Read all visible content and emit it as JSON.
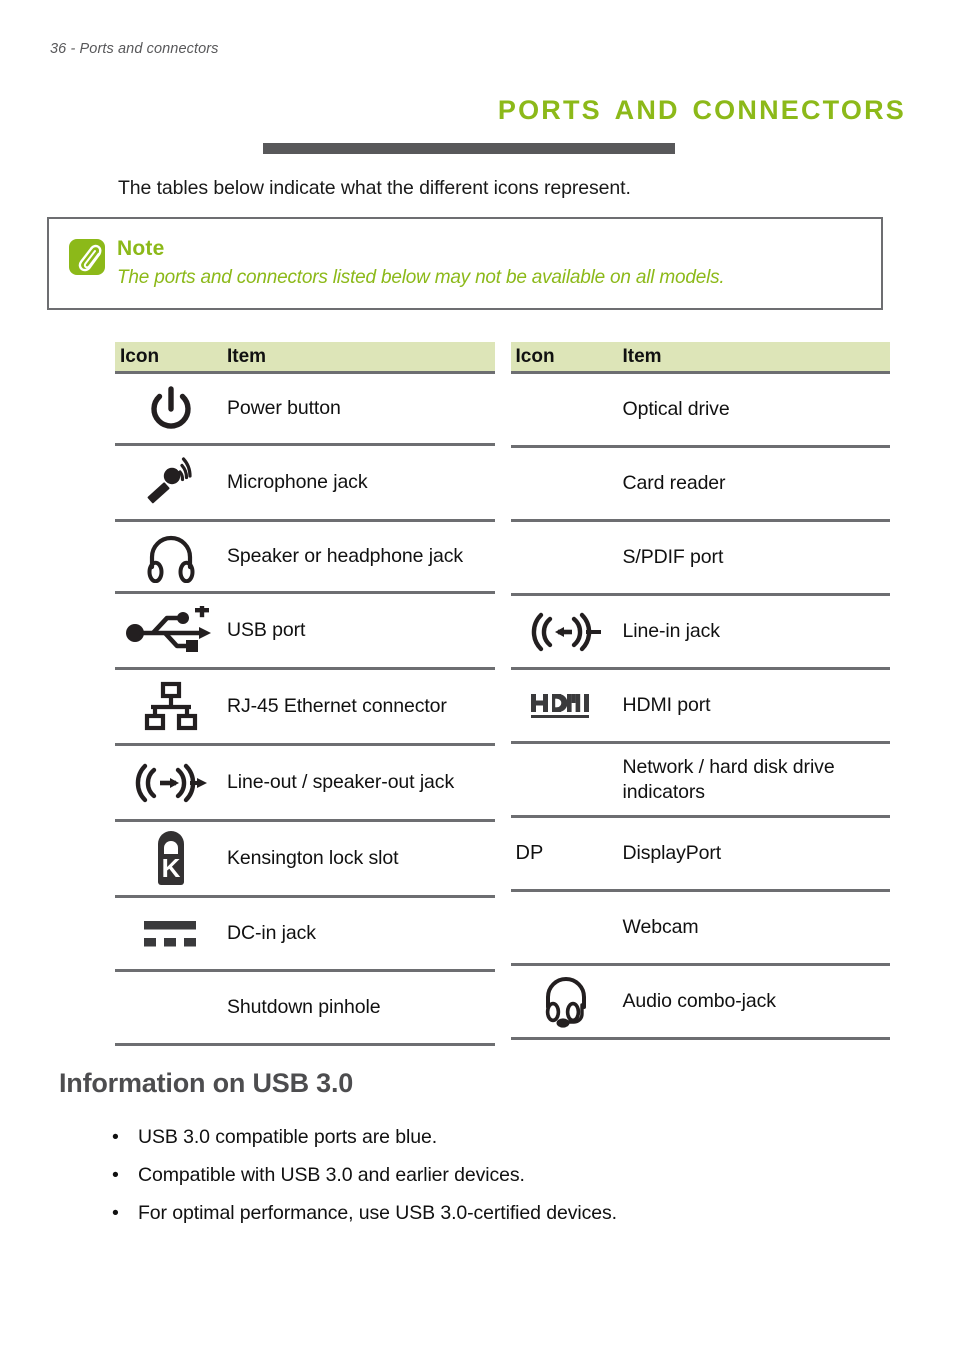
{
  "page": {
    "running_header": "36 - Ports and connectors",
    "title": "Ports and connectors",
    "intro": "The tables below indicate what the different icons represent.",
    "accent_green": "#8cb919",
    "header_fill": "#dde5b8",
    "rule_gray": "#58585a"
  },
  "note": {
    "icon": "note-paperclip-icon",
    "label": "Note",
    "text": "The ports and connectors listed below may not be available on all models."
  },
  "tables": {
    "headers": {
      "icon": "Icon",
      "item": "Item"
    },
    "left": [
      {
        "icon": "power-button-icon",
        "item": "Power button"
      },
      {
        "icon": "microphone-jack-icon",
        "item": "Microphone jack"
      },
      {
        "icon": "headphone-jack-icon",
        "item": "Speaker or headphone jack"
      },
      {
        "icon": "usb-port-icon",
        "item": "USB port"
      },
      {
        "icon": "ethernet-rj45-icon",
        "item": "RJ-45 Ethernet connector"
      },
      {
        "icon": "line-out-jack-icon",
        "item": "Line-out / speaker-out jack"
      },
      {
        "icon": "kensington-lock-icon",
        "item": "Kensington lock slot"
      },
      {
        "icon": "dc-in-jack-icon",
        "item": "DC-in jack"
      },
      {
        "icon": "",
        "item": "Shutdown pinhole"
      }
    ],
    "right": [
      {
        "icon": "",
        "item": "Optical drive"
      },
      {
        "icon": "",
        "item": "Card reader"
      },
      {
        "icon": "",
        "item": "S/PDIF port"
      },
      {
        "icon": "line-in-jack-icon",
        "item": "Line-in jack"
      },
      {
        "icon": "hdmi-logo-icon",
        "item": "HDMI port"
      },
      {
        "icon": "",
        "item": "Network / hard disk drive indicators"
      },
      {
        "icon": "displayport-text-icon",
        "icon_text": "DP",
        "item": "DisplayPort"
      },
      {
        "icon": "",
        "item": "Webcam"
      },
      {
        "icon": "audio-combo-jack-icon",
        "item": "Audio combo-jack"
      }
    ]
  },
  "usb_section": {
    "heading": "Information on USB 3.0",
    "bullet_marker": "•",
    "bullets": [
      "USB 3.0 compatible ports are blue.",
      "Compatible with USB 3.0 and earlier devices.",
      "For optimal performance, use USB 3.0-certified devices."
    ]
  }
}
